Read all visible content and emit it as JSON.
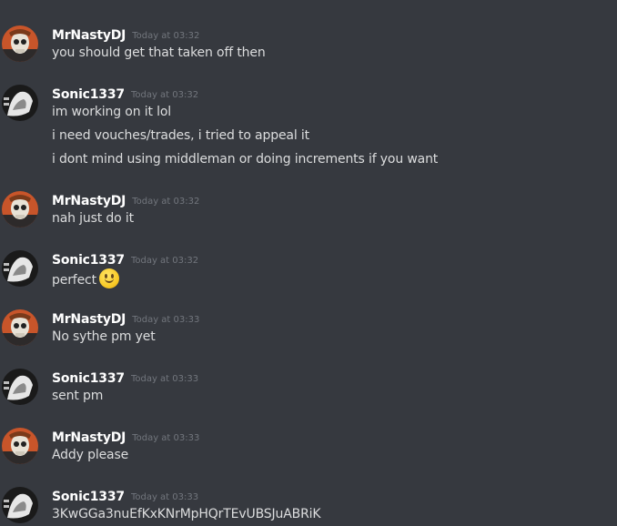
{
  "users": {
    "mrnasty": {
      "name": "MrNastyDJ"
    },
    "sonic": {
      "name": "Sonic1337"
    }
  },
  "messages": [
    {
      "author": "MrNastyDJ",
      "time": "Today at 03:32",
      "lines": [
        "you should get that taken off then"
      ]
    },
    {
      "author": "Sonic1337",
      "time": "Today at 03:32",
      "lines": [
        "im working on it lol",
        "i need vouches/trades, i tried to appeal it",
        "i dont mind using middleman or doing increments if you want"
      ]
    },
    {
      "author": "MrNastyDJ",
      "time": "Today at 03:32",
      "lines": [
        "nah just do it"
      ]
    },
    {
      "author": "Sonic1337",
      "time": "Today at 03:32",
      "lines": [
        "perfect"
      ],
      "emoji": "slightly-smiling-face-icon"
    },
    {
      "author": "MrNastyDJ",
      "time": "Today at 03:33",
      "lines": [
        "No sythe pm yet"
      ]
    },
    {
      "author": "Sonic1337",
      "time": "Today at 03:33",
      "lines": [
        "sent pm"
      ]
    },
    {
      "author": "MrNastyDJ",
      "time": "Today at 03:33",
      "lines": [
        "Addy please"
      ]
    },
    {
      "author": "Sonic1337",
      "time": "Today at 03:33",
      "lines": [
        "3KwGGa3nuEfKxKNrMpHQrTEvUBSJuABRiK"
      ]
    }
  ],
  "colors": {
    "background": "#36393f",
    "username": "#ffffff",
    "timestamp": "#72767d",
    "text": "#dcddde",
    "avatar_mrnasty_bg": "#c8552a",
    "avatar_sonic_bg": "#1a1a1a"
  }
}
